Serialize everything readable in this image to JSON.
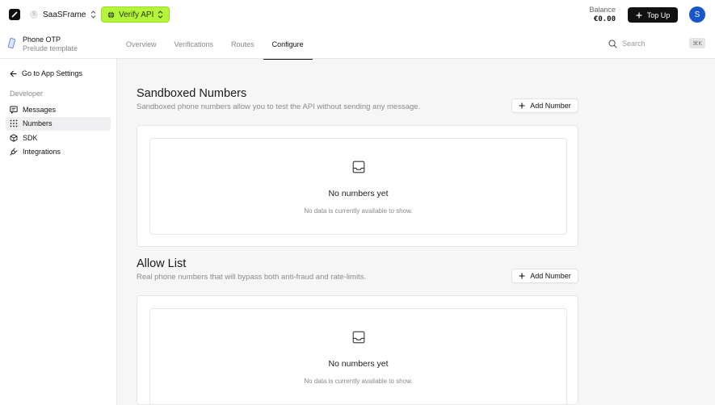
{
  "header": {
    "workspace": "SaaSFrame",
    "workspace_initial": "S",
    "product": "Verify API",
    "balance_label": "Balance",
    "balance_value": "€0.00",
    "top_up_label": "Top Up",
    "avatar_initial": "S",
    "accent_color": "#b4f53c"
  },
  "project": {
    "name": "Phone OTP",
    "subtitle": "Prelude template"
  },
  "tabs": [
    {
      "label": "Overview",
      "active": false
    },
    {
      "label": "Verifications",
      "active": false
    },
    {
      "label": "Routes",
      "active": false
    },
    {
      "label": "Configure",
      "active": true
    }
  ],
  "search": {
    "placeholder": "Search",
    "shortcut": "⌘K"
  },
  "sidebar": {
    "back_label": "Go to App Settings",
    "group_label": "Developer",
    "items": [
      {
        "label": "Messages",
        "icon": "message-icon",
        "active": false
      },
      {
        "label": "Numbers",
        "icon": "grid-icon",
        "active": true
      },
      {
        "label": "SDK",
        "icon": "cube-icon",
        "active": false
      },
      {
        "label": "Integrations",
        "icon": "plug-icon",
        "active": false
      }
    ]
  },
  "sections": [
    {
      "title": "Sandboxed Numbers",
      "description": "Sandboxed phone numbers allow you to test the API without sending any message.",
      "add_label": "Add Number",
      "empty_title": "No numbers yet",
      "empty_desc": "No data is currently available to show."
    },
    {
      "title": "Allow List",
      "description": "Real phone numbers that will bypass both anti-fraud and rate-limits.",
      "add_label": "Add Number",
      "empty_title": "No numbers yet",
      "empty_desc": "No data is currently available to show."
    }
  ]
}
